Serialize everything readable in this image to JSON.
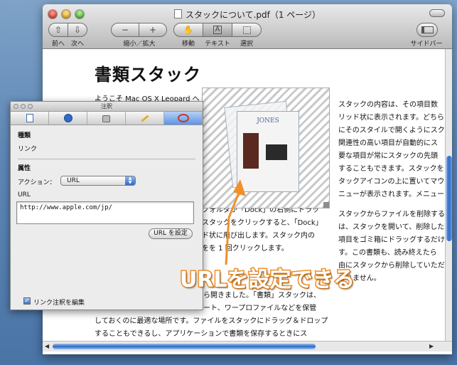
{
  "window": {
    "title": "スタックについて.pdf（1 ページ）",
    "toolbar": {
      "prev_label": "前へ",
      "next_label": "次へ",
      "zoom_label": "縮小／拡大",
      "move_label": "移動",
      "text_label": "テキスト",
      "select_label": "選択",
      "sidebar_label": "サイドバー",
      "zoom_out_glyph": "−",
      "zoom_in_glyph": "+",
      "text_tool_glyph": "A"
    }
  },
  "document": {
    "heading": "書類スタック",
    "left_column": [
      "ようこそ Mac OS X Leopard へ",
      "フォルダが「Dock」の右側にドラッ",
      "スタックをクリックすると、「Dock」",
      "ド状に飛び出します。スタック内の",
      "をを 1 回クリックします。",
      "ら開きました。「書類」スタックは、",
      "ート、ワープロファイルなどを保管",
      "しておくのに最適な場所です。ファイルをスタックにドラッグ＆ドロップ",
      "することもできるし、アプリケーションで書類を保存するときにス"
    ],
    "right_column": [
      "スタックの内容は、その項目数",
      "リッド状に表示されます。どちら",
      "にそのスタイルで開くようにスク",
      "関連性の高い項目が自動的にス",
      "要な項目が常にスタックの先頭",
      "することもできます。スタックを",
      "タックアイコンの上に置いてマウ",
      "ニューが表示されます。メニュー",
      "スタックからファイルを削除する",
      "は、スタックを開いて、削除した",
      "項目をゴミ箱にドラッグするだけ",
      "す。この書類も、読み終えたら",
      "由にスタックから削除していただ",
      "ありません。"
    ],
    "figure_label": "JONES"
  },
  "inspector": {
    "title": "注釈",
    "tabs": [
      "document-icon",
      "search-icon",
      "lock-icon",
      "pencil-icon",
      "oval-icon"
    ],
    "section_type_label": "種類",
    "type_value": "リンク",
    "section_attr_label": "属性",
    "action_label": "アクション：",
    "action_value": "URL",
    "url_label": "URL",
    "url_value": "http://www.apple.com/jp/",
    "set_url_button": "URL を設定",
    "edit_link_label": "リンク注釈を編集",
    "edit_link_checked": true
  },
  "callout": {
    "text": "URLを設定できる",
    "color": "#f0902a"
  }
}
